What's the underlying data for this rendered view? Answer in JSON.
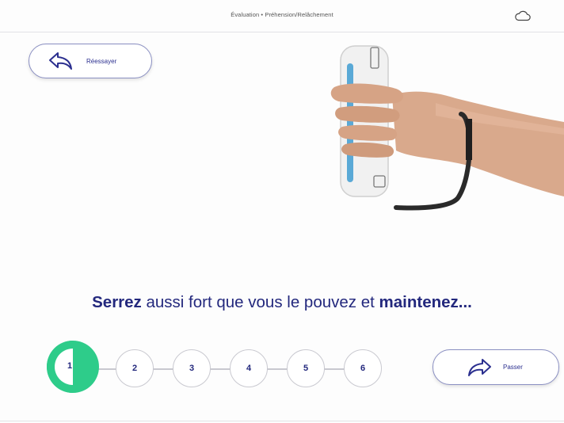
{
  "header": {
    "title": "Évaluation • Préhension/Relâchement",
    "cloud_icon": "cloud-icon"
  },
  "retry_button": {
    "label": "Réessayer",
    "icon": "undo-arrow-icon"
  },
  "skip_button": {
    "label": "Passer",
    "icon": "forward-arrow-icon"
  },
  "instruction": {
    "part1": "Serrez",
    "part2": " aussi fort que vous le pouvez et ",
    "part3": "maintenez..."
  },
  "steps": {
    "labels": [
      "1",
      "2",
      "3",
      "4",
      "5",
      "6"
    ],
    "current": "1",
    "current_progress_fraction": 0.5
  },
  "colors": {
    "accent_green": "#2ecc8a",
    "text_navy": "#23287d",
    "border": "#c9c9d0"
  }
}
